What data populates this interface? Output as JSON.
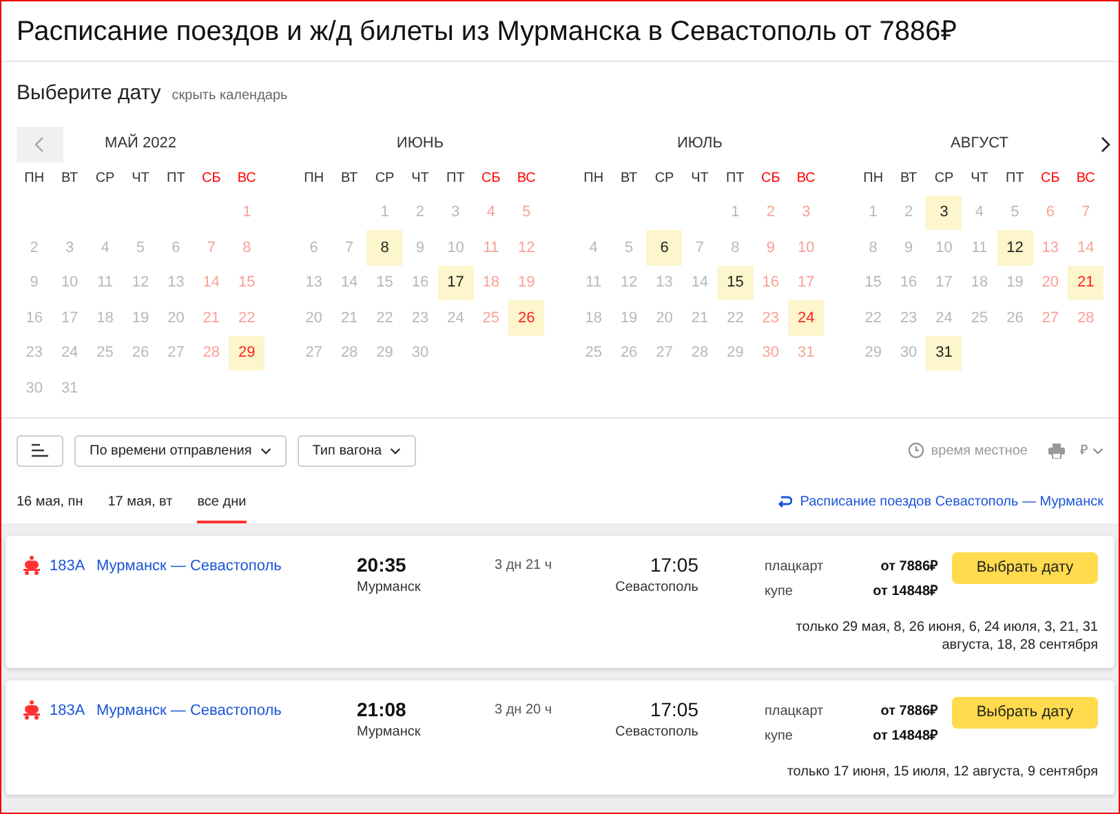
{
  "header": {
    "title": "Расписание поездов и ж/д билеты из Мурманска в Севастополь от 7886₽"
  },
  "calendar": {
    "title": "Выберите дату",
    "hide_link": "скрыть календарь",
    "months": [
      {
        "name": "МАЙ 2022",
        "weekdays": [
          "ПН",
          "ВТ",
          "СР",
          "ЧТ",
          "ПТ",
          "СБ",
          "ВС"
        ],
        "weeks": [
          [
            {
              "d": "1",
              "available": false
            }
          ],
          [
            {
              "d": "2",
              "available": false
            },
            {
              "d": "3",
              "available": false
            },
            {
              "d": "4",
              "available": false
            },
            {
              "d": "5",
              "available": false
            },
            {
              "d": "6",
              "available": false
            },
            {
              "d": "7",
              "available": false
            },
            {
              "d": "8",
              "available": false
            }
          ],
          [
            {
              "d": "9",
              "available": false
            },
            {
              "d": "10",
              "available": false
            },
            {
              "d": "11",
              "available": false
            },
            {
              "d": "12",
              "available": false
            },
            {
              "d": "13",
              "available": false
            },
            {
              "d": "14",
              "available": false
            },
            {
              "d": "15",
              "available": false
            }
          ],
          [
            {
              "d": "16",
              "available": false
            },
            {
              "d": "17",
              "available": false
            },
            {
              "d": "18",
              "available": false
            },
            {
              "d": "19",
              "available": false
            },
            {
              "d": "20",
              "available": false
            },
            {
              "d": "21",
              "available": false
            },
            {
              "d": "22",
              "available": false
            }
          ],
          [
            {
              "d": "23",
              "available": false
            },
            {
              "d": "24",
              "available": false
            },
            {
              "d": "25",
              "available": false
            },
            {
              "d": "26",
              "available": false
            },
            {
              "d": "27",
              "available": false
            },
            {
              "d": "28",
              "available": false
            },
            {
              "d": "29",
              "available": true
            }
          ],
          [
            {
              "d": "30",
              "available": false
            },
            {
              "d": "31",
              "available": false
            }
          ]
        ]
      },
      {
        "name": "ИЮНЬ",
        "weekdays": [
          "ПН",
          "ВТ",
          "СР",
          "ЧТ",
          "ПТ",
          "СБ",
          "ВС"
        ],
        "weeks": [
          [
            {
              "d": "1",
              "available": false
            },
            {
              "d": "2",
              "available": false
            },
            {
              "d": "3",
              "available": false
            },
            {
              "d": "4",
              "available": false
            },
            {
              "d": "5",
              "available": false
            }
          ],
          [
            {
              "d": "6",
              "available": false
            },
            {
              "d": "7",
              "available": false
            },
            {
              "d": "8",
              "available": true
            },
            {
              "d": "9",
              "available": false
            },
            {
              "d": "10",
              "available": false
            },
            {
              "d": "11",
              "available": false
            },
            {
              "d": "12",
              "available": false
            }
          ],
          [
            {
              "d": "13",
              "available": false
            },
            {
              "d": "14",
              "available": false
            },
            {
              "d": "15",
              "available": false
            },
            {
              "d": "16",
              "available": false
            },
            {
              "d": "17",
              "available": true
            },
            {
              "d": "18",
              "available": false
            },
            {
              "d": "19",
              "available": false
            }
          ],
          [
            {
              "d": "20",
              "available": false
            },
            {
              "d": "21",
              "available": false
            },
            {
              "d": "22",
              "available": false
            },
            {
              "d": "23",
              "available": false
            },
            {
              "d": "24",
              "available": false
            },
            {
              "d": "25",
              "available": false
            },
            {
              "d": "26",
              "available": true
            }
          ],
          [
            {
              "d": "27",
              "available": false
            },
            {
              "d": "28",
              "available": false
            },
            {
              "d": "29",
              "available": false
            },
            {
              "d": "30",
              "available": false
            }
          ]
        ]
      },
      {
        "name": "ИЮЛЬ",
        "weekdays": [
          "ПН",
          "ВТ",
          "СР",
          "ЧТ",
          "ПТ",
          "СБ",
          "ВС"
        ],
        "weeks": [
          [
            {
              "d": "1",
              "available": false
            },
            {
              "d": "2",
              "available": false
            },
            {
              "d": "3",
              "available": false
            }
          ],
          [
            {
              "d": "4",
              "available": false
            },
            {
              "d": "5",
              "available": false
            },
            {
              "d": "6",
              "available": true
            },
            {
              "d": "7",
              "available": false
            },
            {
              "d": "8",
              "available": false
            },
            {
              "d": "9",
              "available": false
            },
            {
              "d": "10",
              "available": false
            }
          ],
          [
            {
              "d": "11",
              "available": false
            },
            {
              "d": "12",
              "available": false
            },
            {
              "d": "13",
              "available": false
            },
            {
              "d": "14",
              "available": false
            },
            {
              "d": "15",
              "available": true
            },
            {
              "d": "16",
              "available": false
            },
            {
              "d": "17",
              "available": false
            }
          ],
          [
            {
              "d": "18",
              "available": false
            },
            {
              "d": "19",
              "available": false
            },
            {
              "d": "20",
              "available": false
            },
            {
              "d": "21",
              "available": false
            },
            {
              "d": "22",
              "available": false
            },
            {
              "d": "23",
              "available": false
            },
            {
              "d": "24",
              "available": true
            }
          ],
          [
            {
              "d": "25",
              "available": false
            },
            {
              "d": "26",
              "available": false
            },
            {
              "d": "27",
              "available": false
            },
            {
              "d": "28",
              "available": false
            },
            {
              "d": "29",
              "available": false
            },
            {
              "d": "30",
              "available": false
            },
            {
              "d": "31",
              "available": false
            }
          ]
        ]
      },
      {
        "name": "АВГУСТ",
        "weekdays": [
          "ПН",
          "ВТ",
          "СР",
          "ЧТ",
          "ПТ",
          "СБ",
          "ВС"
        ],
        "weeks": [
          [
            {
              "d": "1",
              "available": false
            },
            {
              "d": "2",
              "available": false
            },
            {
              "d": "3",
              "available": true
            },
            {
              "d": "4",
              "available": false
            },
            {
              "d": "5",
              "available": false
            },
            {
              "d": "6",
              "available": false
            },
            {
              "d": "7",
              "available": false
            }
          ],
          [
            {
              "d": "8",
              "available": false
            },
            {
              "d": "9",
              "available": false
            },
            {
              "d": "10",
              "available": false
            },
            {
              "d": "11",
              "available": false
            },
            {
              "d": "12",
              "available": true
            },
            {
              "d": "13",
              "available": false
            },
            {
              "d": "14",
              "available": false
            }
          ],
          [
            {
              "d": "15",
              "available": false
            },
            {
              "d": "16",
              "available": false
            },
            {
              "d": "17",
              "available": false
            },
            {
              "d": "18",
              "available": false
            },
            {
              "d": "19",
              "available": false
            },
            {
              "d": "20",
              "available": false
            },
            {
              "d": "21",
              "available": true
            }
          ],
          [
            {
              "d": "22",
              "available": false
            },
            {
              "d": "23",
              "available": false
            },
            {
              "d": "24",
              "available": false
            },
            {
              "d": "25",
              "available": false
            },
            {
              "d": "26",
              "available": false
            },
            {
              "d": "27",
              "available": false
            },
            {
              "d": "28",
              "available": false
            }
          ],
          [
            {
              "d": "29",
              "available": false
            },
            {
              "d": "30",
              "available": false
            },
            {
              "d": "31",
              "available": true
            }
          ]
        ]
      }
    ]
  },
  "toolbar": {
    "dropdowns": [
      "По времени отправления",
      "Тип вагона"
    ],
    "time_note": "время местное",
    "currency": "₽"
  },
  "date_tabs": [
    {
      "label": "16 мая, пн",
      "selected": false
    },
    {
      "label": "17 мая, вт",
      "selected": false
    },
    {
      "label": "все дни",
      "selected": true
    }
  ],
  "reverse_link": "Расписание поездов Севастополь — Мурманск",
  "trains": [
    {
      "number": "183А",
      "route": "Мурманск — Севастополь",
      "departure_time": "20:35",
      "departure_station": "Мурманск",
      "duration": "3 дн 21 ч",
      "arrival_time": "17:05",
      "arrival_station": "Севастополь",
      "fares": [
        {
          "class": "плацкарт",
          "price": "от 7886₽"
        },
        {
          "class": "купе",
          "price": "от 14848₽"
        }
      ],
      "button": "Выбрать дату",
      "note": "только 29 мая, 8, 26 июня, 6, 24 июля, 3, 21, 31 августа, 18, 28 сентября"
    },
    {
      "number": "183А",
      "route": "Мурманск — Севастополь",
      "departure_time": "21:08",
      "departure_station": "Мурманск",
      "duration": "3 дн 20 ч",
      "arrival_time": "17:05",
      "arrival_station": "Севастополь",
      "fares": [
        {
          "class": "плацкарт",
          "price": "от 7886₽"
        },
        {
          "class": "купе",
          "price": "от 14848₽"
        }
      ],
      "button": "Выбрать дату",
      "note": "только 17 июня, 15 июля, 12 августа, 9 сентября"
    }
  ]
}
